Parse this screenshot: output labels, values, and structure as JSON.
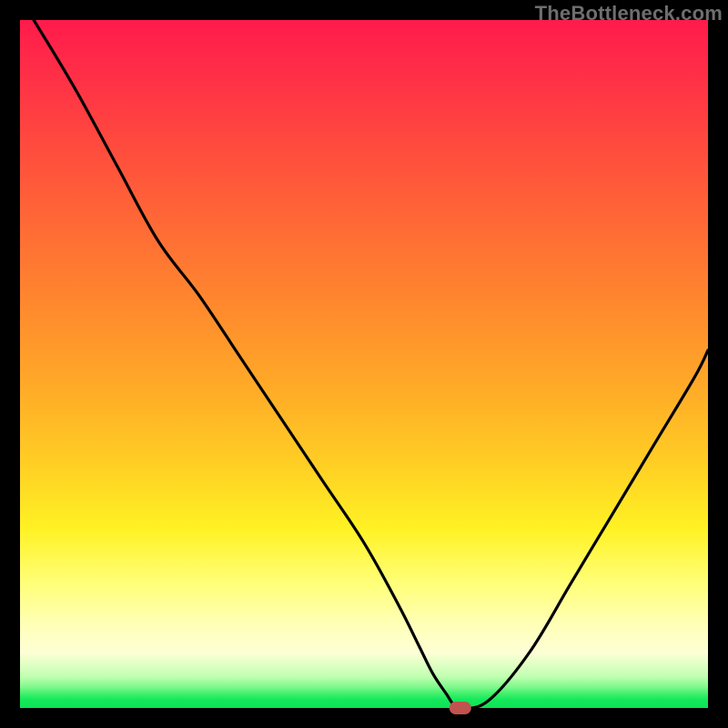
{
  "watermark": "TheBottleneck.com",
  "chart_data": {
    "type": "line",
    "title": "",
    "xlabel": "",
    "ylabel": "",
    "xlim": [
      0,
      100
    ],
    "ylim": [
      0,
      100
    ],
    "grid": false,
    "legend": false,
    "series": [
      {
        "name": "bottleneck-curve",
        "x": [
          2,
          8,
          14,
          20,
          26,
          32,
          38,
          44,
          50,
          55,
          58,
          60,
          62,
          63,
          64,
          68,
          74,
          80,
          86,
          92,
          98,
          100
        ],
        "y": [
          100,
          90,
          79,
          68,
          60,
          51,
          42,
          33,
          24,
          15,
          9,
          5,
          2,
          0.5,
          0,
          1,
          8,
          18,
          28,
          38,
          48,
          52
        ]
      }
    ],
    "marker": {
      "name": "optimal-point",
      "x": 64,
      "y": 0,
      "shape": "pill",
      "color": "#c0534f"
    },
    "background_gradient": {
      "direction": "top-to-bottom",
      "stops": [
        {
          "pos": 0.0,
          "color": "#ff1b4b"
        },
        {
          "pos": 0.3,
          "color": "#ff6a35"
        },
        {
          "pos": 0.65,
          "color": "#ffd024"
        },
        {
          "pos": 0.88,
          "color": "#ffffb8"
        },
        {
          "pos": 0.97,
          "color": "#7cf88a"
        },
        {
          "pos": 1.0,
          "color": "#0de257"
        }
      ]
    }
  }
}
